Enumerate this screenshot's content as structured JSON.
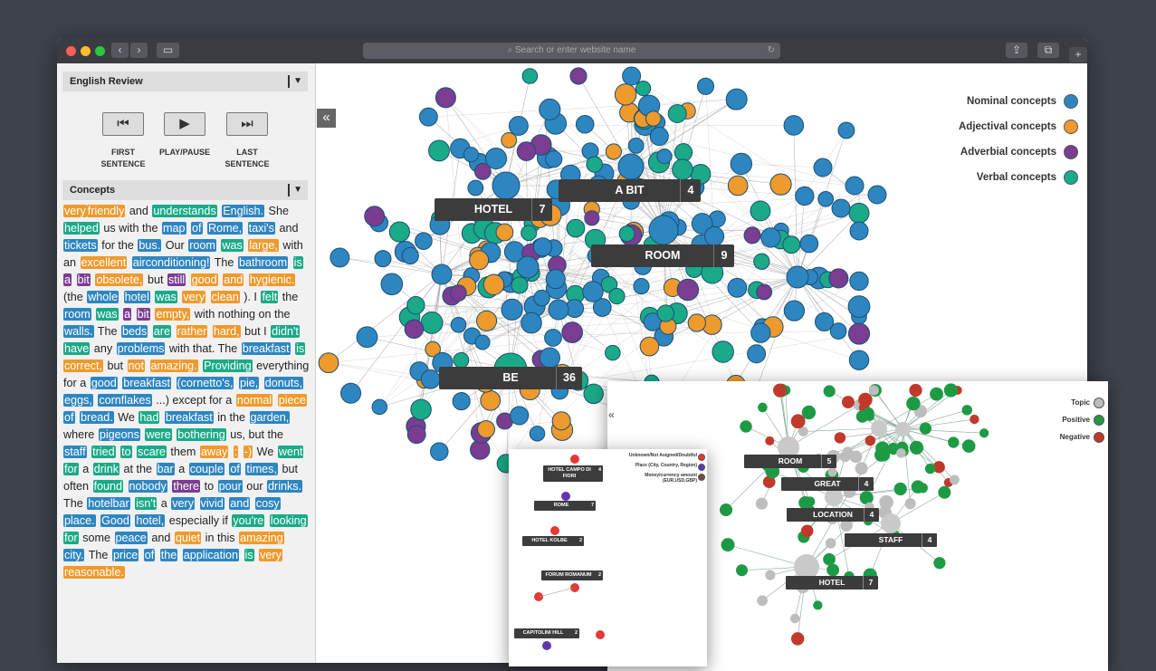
{
  "browser": {
    "url_placeholder": "Search or enter website name",
    "nav_back": "‹",
    "nav_forward": "›",
    "sidebar_toggle": "▭",
    "share": "⇪",
    "tabs": "⧉",
    "new_tab": "+",
    "reload": "↻",
    "search_glyph": "⌕"
  },
  "sidebar": {
    "review_title": "English Review",
    "concepts_title": "Concepts",
    "player": {
      "first_icon": "⏮",
      "play_icon": "▶",
      "last_icon": "⏭",
      "first_label": "FIRST\nSENTENCE",
      "play_label": "PLAY/PAUSE",
      "last_label": "LAST\nSENTENCE"
    },
    "tokens": [
      [
        "very",
        "a"
      ],
      [
        "friendly",
        "a"
      ],
      [
        " and ",
        ""
      ],
      [
        "understands",
        "v"
      ],
      [
        " ",
        ""
      ],
      [
        "English.",
        "n"
      ],
      [
        " She ",
        ""
      ],
      [
        "helped",
        "v"
      ],
      [
        " us with the ",
        ""
      ],
      [
        "map",
        "n"
      ],
      [
        " ",
        ""
      ],
      [
        "of",
        "n"
      ],
      [
        " ",
        ""
      ],
      [
        "Rome,",
        "n"
      ],
      [
        " ",
        ""
      ],
      [
        "taxi's",
        "n"
      ],
      [
        " and ",
        ""
      ],
      [
        "tickets",
        "n"
      ],
      [
        " for the ",
        ""
      ],
      [
        "bus.",
        "n"
      ],
      [
        " Our ",
        ""
      ],
      [
        "room",
        "n"
      ],
      [
        " ",
        ""
      ],
      [
        "was",
        "v"
      ],
      [
        " ",
        ""
      ],
      [
        "large,",
        "a"
      ],
      [
        " with an ",
        ""
      ],
      [
        "excellent",
        "a"
      ],
      [
        " ",
        ""
      ],
      [
        "airconditioning!",
        "n"
      ],
      [
        " The ",
        ""
      ],
      [
        "bathroom",
        "n"
      ],
      [
        " ",
        ""
      ],
      [
        "is",
        "v"
      ],
      [
        " ",
        ""
      ],
      [
        "a",
        "d"
      ],
      [
        " ",
        ""
      ],
      [
        "bit",
        "d"
      ],
      [
        " ",
        ""
      ],
      [
        "obsolete,",
        "a"
      ],
      [
        " but ",
        ""
      ],
      [
        "still",
        "d"
      ],
      [
        " ",
        ""
      ],
      [
        "good",
        "a"
      ],
      [
        " ",
        ""
      ],
      [
        "and",
        "a"
      ],
      [
        " ",
        ""
      ],
      [
        "hygienic.",
        "a"
      ],
      [
        " (the ",
        ""
      ],
      [
        "whole",
        "n"
      ],
      [
        " ",
        ""
      ],
      [
        "hotel",
        "n"
      ],
      [
        " ",
        ""
      ],
      [
        "was",
        "v"
      ],
      [
        " ",
        ""
      ],
      [
        "very",
        "a"
      ],
      [
        " ",
        ""
      ],
      [
        "clean",
        "a"
      ],
      [
        " ). I ",
        ""
      ],
      [
        "felt",
        "v"
      ],
      [
        " the ",
        ""
      ],
      [
        "room",
        "n"
      ],
      [
        " ",
        ""
      ],
      [
        "was",
        "v"
      ],
      [
        " ",
        ""
      ],
      [
        "a",
        "d"
      ],
      [
        " ",
        ""
      ],
      [
        "bit",
        "d"
      ],
      [
        " ",
        ""
      ],
      [
        "empty,",
        "a"
      ],
      [
        " with nothing on the ",
        ""
      ],
      [
        "walls.",
        "n"
      ],
      [
        " The ",
        ""
      ],
      [
        "beds",
        "n"
      ],
      [
        " ",
        ""
      ],
      [
        "are",
        "v"
      ],
      [
        " ",
        ""
      ],
      [
        "rather",
        "a"
      ],
      [
        " ",
        ""
      ],
      [
        "hard,",
        "a"
      ],
      [
        " but I ",
        ""
      ],
      [
        "didn't",
        "v"
      ],
      [
        " ",
        ""
      ],
      [
        "have",
        "v"
      ],
      [
        " any ",
        ""
      ],
      [
        "problems",
        "n"
      ],
      [
        " with that. The ",
        ""
      ],
      [
        "breakfast",
        "n"
      ],
      [
        " ",
        ""
      ],
      [
        "is",
        "v"
      ],
      [
        " ",
        ""
      ],
      [
        "correct,",
        "a"
      ],
      [
        " but ",
        ""
      ],
      [
        "not",
        "a"
      ],
      [
        " ",
        ""
      ],
      [
        "amazing.",
        "a"
      ],
      [
        " ",
        ""
      ],
      [
        "Providing",
        "v"
      ],
      [
        " everything for a ",
        ""
      ],
      [
        "good",
        "n"
      ],
      [
        " ",
        ""
      ],
      [
        "breakfast",
        "n"
      ],
      [
        " ",
        ""
      ],
      [
        "(cornetto's,",
        "n"
      ],
      [
        " ",
        ""
      ],
      [
        "pie,",
        "n"
      ],
      [
        " ",
        ""
      ],
      [
        "donuts,",
        "n"
      ],
      [
        " ",
        ""
      ],
      [
        "eggs,",
        "n"
      ],
      [
        " ",
        ""
      ],
      [
        "cornflakes",
        "n"
      ],
      [
        " ...) except for a ",
        ""
      ],
      [
        "normal",
        "a"
      ],
      [
        " ",
        ""
      ],
      [
        "piece",
        "a"
      ],
      [
        " ",
        ""
      ],
      [
        "of",
        "n"
      ],
      [
        " ",
        ""
      ],
      [
        "bread.",
        "n"
      ],
      [
        " We ",
        ""
      ],
      [
        "had",
        "v"
      ],
      [
        " ",
        ""
      ],
      [
        "breakfast",
        "n"
      ],
      [
        " in the ",
        ""
      ],
      [
        "garden,",
        "n"
      ],
      [
        " where ",
        ""
      ],
      [
        "pigeons",
        "n"
      ],
      [
        " ",
        ""
      ],
      [
        "were",
        "v"
      ],
      [
        " ",
        ""
      ],
      [
        "bothering",
        "v"
      ],
      [
        " us, but the ",
        ""
      ],
      [
        "staff",
        "n"
      ],
      [
        " ",
        ""
      ],
      [
        "tried",
        "v"
      ],
      [
        " ",
        ""
      ],
      [
        "to",
        "v"
      ],
      [
        " ",
        ""
      ],
      [
        "scare",
        "v"
      ],
      [
        " them ",
        ""
      ],
      [
        "away",
        "a"
      ],
      [
        " ",
        ""
      ],
      [
        ":",
        "a"
      ],
      [
        " ",
        ""
      ],
      [
        "-)",
        "a"
      ],
      [
        " We ",
        ""
      ],
      [
        "went",
        "v"
      ],
      [
        " ",
        ""
      ],
      [
        "for",
        "v"
      ],
      [
        " a ",
        ""
      ],
      [
        "drink",
        "v"
      ],
      [
        " at the ",
        ""
      ],
      [
        "bar",
        "n"
      ],
      [
        " a ",
        ""
      ],
      [
        "couple",
        "n"
      ],
      [
        " ",
        ""
      ],
      [
        "of",
        "n"
      ],
      [
        " ",
        ""
      ],
      [
        "times,",
        "n"
      ],
      [
        " but often ",
        ""
      ],
      [
        "found",
        "v"
      ],
      [
        " ",
        ""
      ],
      [
        "nobody",
        "n"
      ],
      [
        " ",
        ""
      ],
      [
        "there",
        "d"
      ],
      [
        " to ",
        ""
      ],
      [
        "pour",
        "n"
      ],
      [
        " our ",
        ""
      ],
      [
        "drinks.",
        "n"
      ],
      [
        " The ",
        ""
      ],
      [
        "hotelbar",
        "n"
      ],
      [
        " ",
        ""
      ],
      [
        "isn't",
        "v"
      ],
      [
        " a ",
        ""
      ],
      [
        "very",
        "n"
      ],
      [
        " ",
        ""
      ],
      [
        "vivid",
        "n"
      ],
      [
        " ",
        ""
      ],
      [
        "and",
        "n"
      ],
      [
        " ",
        ""
      ],
      [
        "cosy",
        "n"
      ],
      [
        " ",
        ""
      ],
      [
        "place.",
        "n"
      ],
      [
        " ",
        ""
      ],
      [
        "Good",
        "n"
      ],
      [
        " ",
        ""
      ],
      [
        "hotel,",
        "n"
      ],
      [
        " especially if ",
        ""
      ],
      [
        "you're",
        "v"
      ],
      [
        " ",
        ""
      ],
      [
        "looking",
        "v"
      ],
      [
        " ",
        ""
      ],
      [
        "for",
        "v"
      ],
      [
        " some ",
        ""
      ],
      [
        "peace",
        "n"
      ],
      [
        " and ",
        ""
      ],
      [
        "quiet",
        "a"
      ],
      [
        " in this ",
        ""
      ],
      [
        "amazing",
        "a"
      ],
      [
        " ",
        ""
      ],
      [
        "city.",
        "n"
      ],
      [
        " The ",
        ""
      ],
      [
        "price",
        "n"
      ],
      [
        " ",
        ""
      ],
      [
        "of",
        "n"
      ],
      [
        " ",
        ""
      ],
      [
        "the",
        "n"
      ],
      [
        " ",
        ""
      ],
      [
        "application",
        "n"
      ],
      [
        " ",
        ""
      ],
      [
        "is",
        "v"
      ],
      [
        " ",
        ""
      ],
      [
        "very",
        "a"
      ],
      [
        " ",
        ""
      ],
      [
        "reasonable.",
        "a"
      ]
    ]
  },
  "main_graph": {
    "collapse_icon": "«",
    "legend": [
      {
        "label": "Nominal concepts",
        "color": "#2e86c1"
      },
      {
        "label": "Adjectival concepts",
        "color": "#ef9a2d"
      },
      {
        "label": "Adverbial concepts",
        "color": "#7a3d91"
      },
      {
        "label": "Verbal concepts",
        "color": "#1aaa87"
      }
    ],
    "labels": [
      {
        "text": "HOTEL",
        "count": "7"
      },
      {
        "text": "A BIT",
        "count": "4"
      },
      {
        "text": "ROOM",
        "count": "9"
      },
      {
        "text": "BE",
        "count": "36"
      }
    ]
  },
  "topic_graph": {
    "collapse_icon": "«",
    "legend": [
      {
        "label": "Topic",
        "color": "#bdbdbd"
      },
      {
        "label": "Positive",
        "color": "#1e9a45"
      },
      {
        "label": "Negative",
        "color": "#c0392b"
      }
    ],
    "labels": [
      {
        "text": "ROOM",
        "count": "5"
      },
      {
        "text": "GREAT",
        "count": "4"
      },
      {
        "text": "LOCATION",
        "count": "4"
      },
      {
        "text": "STAFF",
        "count": "4"
      },
      {
        "text": "HOTEL",
        "count": "7"
      }
    ]
  },
  "entity_graph": {
    "legend": [
      {
        "label": "Unknown/Not Asigned/Doubtful",
        "color": "#e53935"
      },
      {
        "label": "Place (City, Country, Region)",
        "color": "#5e35b1"
      },
      {
        "label": "Money/currency amount (EUR,USD,GBP)",
        "color": "#6d4c41"
      }
    ],
    "labels": [
      {
        "text": "HOTEL CAMPO DI FIORI",
        "count": "4"
      },
      {
        "text": "ROME",
        "count": "7"
      },
      {
        "text": "HOTEL KOLBE",
        "count": "2"
      },
      {
        "text": "FORUM ROMANUM",
        "count": "2"
      },
      {
        "text": "CAPITOLINI HILL",
        "count": "2"
      }
    ]
  }
}
